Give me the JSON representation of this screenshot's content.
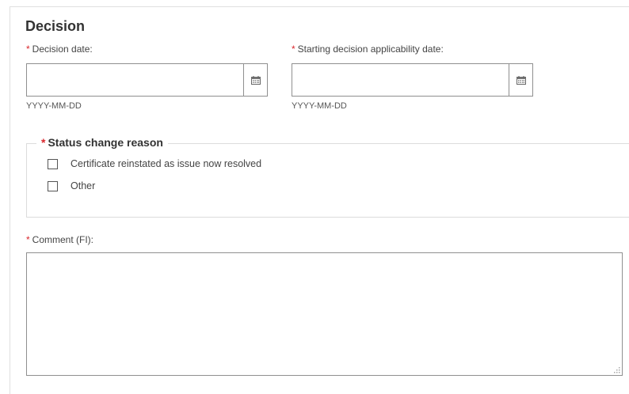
{
  "section": {
    "title": "Decision"
  },
  "decision_date": {
    "required_mark": "*",
    "label": "Decision date:",
    "value": "",
    "hint": "YYYY-MM-DD",
    "icon": "calendar-icon"
  },
  "applicability_date": {
    "required_mark": "*",
    "label": "Starting decision applicability date:",
    "value": "",
    "hint": "YYYY-MM-DD",
    "icon": "calendar-icon"
  },
  "status_change_reason": {
    "required_mark": "*",
    "legend": "Status change reason",
    "options": [
      {
        "label": "Certificate reinstated as issue now resolved",
        "checked": false
      },
      {
        "label": "Other",
        "checked": false
      }
    ]
  },
  "comment": {
    "required_mark": "*",
    "label": "Comment (FI):",
    "value": ""
  },
  "colors": {
    "required": "#d9262c",
    "text": "#333333",
    "border": "#8f8f8f"
  }
}
